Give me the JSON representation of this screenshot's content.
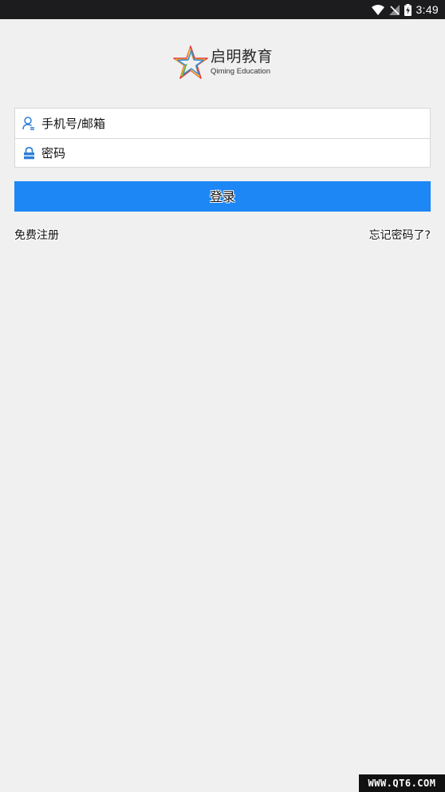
{
  "status_bar": {
    "time": "3:49",
    "icons": [
      "wifi-icon",
      "no-signal-icon",
      "battery-charging-icon"
    ]
  },
  "logo": {
    "name_cn": "启明教育",
    "name_en": "Qiming Education",
    "star_colors": [
      "#e23b3b",
      "#f5a623",
      "#2e8bd6",
      "#5bb548"
    ]
  },
  "form": {
    "account": {
      "placeholder": "手机号/邮箱",
      "value": "",
      "icon": "user-icon"
    },
    "password": {
      "placeholder": "密码",
      "value": "",
      "icon": "lock-icon"
    }
  },
  "login_button": {
    "label": "登录",
    "color": "#1c87f5"
  },
  "links": {
    "register": "免费注册",
    "forgot": "忘记密码了?"
  },
  "watermark": "WWW.QT6.COM"
}
